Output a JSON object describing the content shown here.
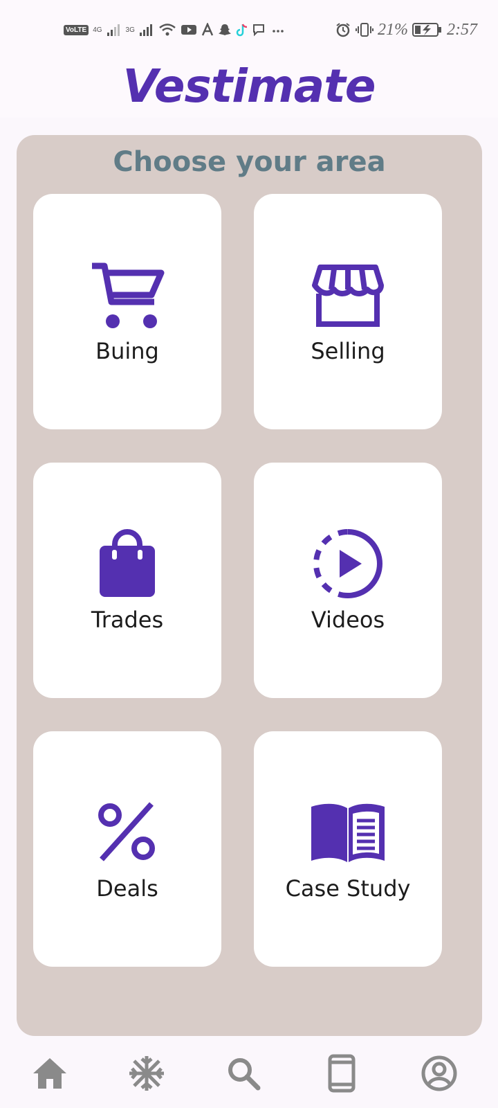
{
  "status_bar": {
    "volte": "VoLTE",
    "net1": "4G",
    "net2": "3G",
    "battery_pct": "21%",
    "time": "2:57"
  },
  "header": {
    "title": "Vestimate"
  },
  "main": {
    "title": "Choose your area",
    "tiles": [
      {
        "label": "Buing",
        "icon": "shopping-cart-icon"
      },
      {
        "label": "Selling",
        "icon": "storefront-icon"
      },
      {
        "label": "Trades",
        "icon": "shopping-bag-icon"
      },
      {
        "label": "Videos",
        "icon": "play-circle-icon"
      },
      {
        "label": "Deals",
        "icon": "percent-icon"
      },
      {
        "label": "Case Study",
        "icon": "open-book-icon"
      }
    ]
  },
  "bottom_nav": {
    "items": [
      {
        "icon": "home-icon"
      },
      {
        "icon": "snowflake-icon"
      },
      {
        "icon": "search-icon"
      },
      {
        "icon": "phone-icon"
      },
      {
        "icon": "account-icon"
      }
    ]
  },
  "colors": {
    "accent": "#5430b0",
    "panel": "#d8ccc8",
    "title": "#607c87",
    "nav_icon": "#8a8a8a"
  }
}
